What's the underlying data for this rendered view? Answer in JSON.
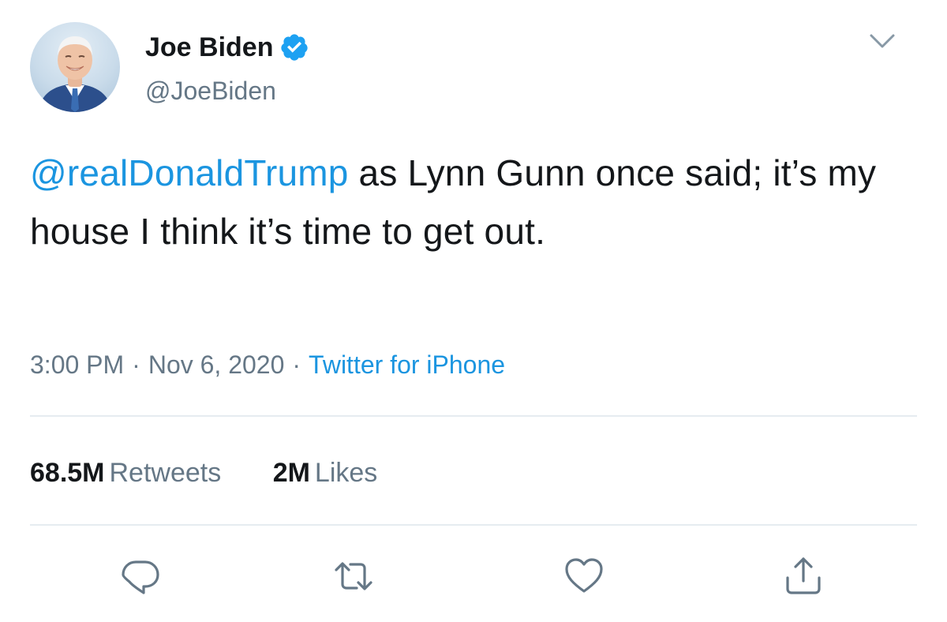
{
  "author": {
    "name": "Joe Biden",
    "handle": "@JoeBiden",
    "verified": true
  },
  "tweet": {
    "mention": "@realDonaldTrump",
    "text": " as Lynn Gunn once said; it’s my house I think it’s time to get out."
  },
  "meta": {
    "time": "3:00 PM",
    "date": "Nov 6, 2020",
    "source": "Twitter for iPhone",
    "separator": "·"
  },
  "stats": {
    "retweets_count": "68.5M",
    "retweets_label": "Retweets",
    "likes_count": "2M",
    "likes_label": "Likes"
  },
  "icons": {
    "menu": "chevron-down-icon",
    "verified": "verified-badge-icon",
    "reply": "reply-icon",
    "retweet": "retweet-icon",
    "like": "heart-icon",
    "share": "share-icon"
  },
  "colors": {
    "link": "#1b95e0",
    "verified": "#1da1f2",
    "secondary_text": "#657786",
    "primary_text": "#14171a",
    "divider": "#e6ecf0"
  }
}
